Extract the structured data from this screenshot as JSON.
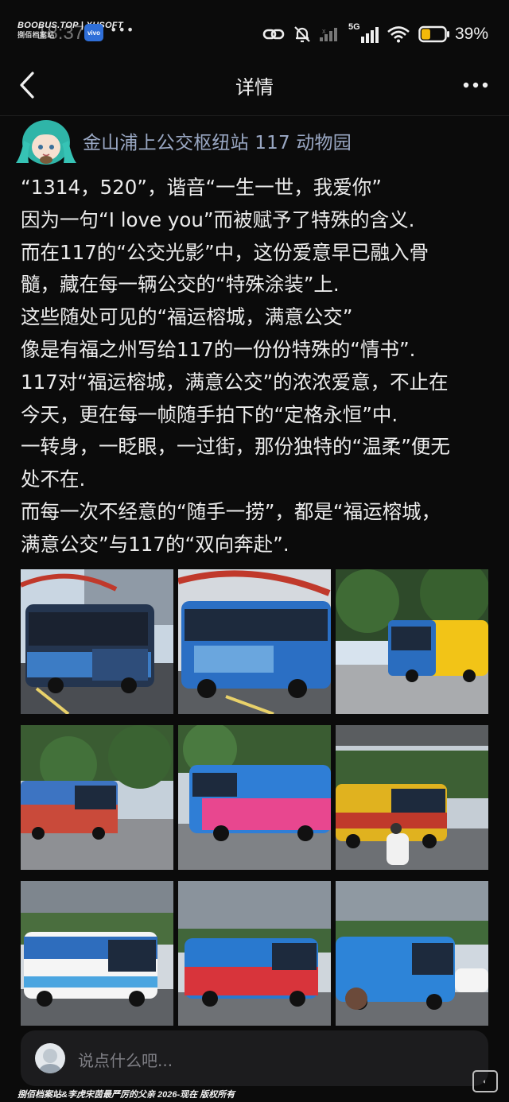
{
  "watermark": {
    "top_line1": "BOOBUS.TOP | XHSOFT",
    "top_line2": "捌佰档案站",
    "bottom": "捌佰档案站&李虎宋茵最严厉的父亲 2026-现在 版权所有"
  },
  "status_bar": {
    "time": "18:37",
    "app_icon_label": "vivo",
    "network": "5G",
    "battery_percent": "39%",
    "battery_level": 0.39,
    "battery_color": "#f2b90a"
  },
  "nav": {
    "title": "详情",
    "back_icon": "chevron-left-icon",
    "more_icon": "more-horizontal-icon"
  },
  "post": {
    "group_name": "金山浦上公交枢纽站 117 动物园",
    "lines": [
      "“1314，520”，谐音“一生一世，我爱你”",
      "因为一句“I love you”而被赋予了特殊的含义.",
      "而在117的“公交光影”中，这份爱意早已融入骨",
      "髓，藏在每一辆公交的“特殊涂装”上.",
      "这些随处可见的“福运榕城，满意公交”",
      "像是有福之州写给117的一份份特殊的“情书”.",
      "117对“福运榕城，满意公交”的浓浓爱意，不止在",
      "今天，更在每一帧随手拍下的“定格永恒”中.",
      "一转身，一眨眼，一过街，那份独特的“温柔”便无",
      "处不在.",
      "而每一次不经意的“随手一捞”，都是“福运榕城，",
      "满意公交”与117的“双向奔赴”."
    ],
    "photos_count": 9
  },
  "comment": {
    "placeholder": "说点什么吧..."
  },
  "colors": {
    "accent_link": "#9aa8c4",
    "background": "#0b0b0b",
    "bus_blue": "#1e7fd6",
    "bus_pink": "#e8478f",
    "bus_yellow": "#f2c417"
  }
}
